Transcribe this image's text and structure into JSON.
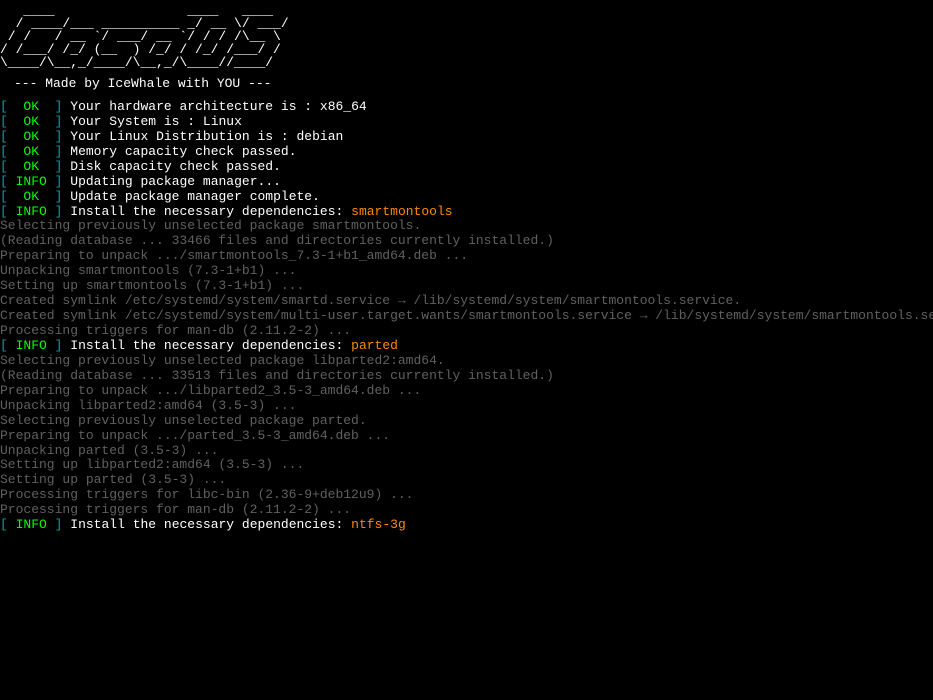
{
  "ascii_art": "   ____                 ____   ____\n  / ____/___ __________ _/ __ \\/ ___/\n / /   / __ `/ ___/ __ `/ / / /\\__ \\\n/ /___/ /_/ (__  ) /_/ / /_/ /___/ /\n\\____/\\__,_/____/\\__,_/\\____//____/",
  "tagline": "--- Made by IceWhale with YOU ---",
  "status_lines": [
    {
      "type": "ok",
      "message": "Your hardware architecture is : x86_64"
    },
    {
      "type": "ok",
      "message": "Your System is : Linux"
    },
    {
      "type": "ok",
      "message": "Your Linux Distribution is : debian"
    },
    {
      "type": "ok",
      "message": "Memory capacity check passed."
    },
    {
      "type": "ok",
      "message": "Disk capacity check passed."
    },
    {
      "type": "info",
      "message": "Updating package manager..."
    },
    {
      "type": "ok",
      "message": "Update package manager complete."
    },
    {
      "type": "info",
      "message": "Install the necessary dependencies: ",
      "pkg": "smartmontools"
    }
  ],
  "output_block_1": [
    "Selecting previously unselected package smartmontools.",
    "(Reading database ... 33466 files and directories currently installed.)",
    "Preparing to unpack .../smartmontools_7.3-1+b1_amd64.deb ...",
    "Unpacking smartmontools (7.3-1+b1) ...",
    "Setting up smartmontools (7.3-1+b1) ...",
    "Created symlink /etc/systemd/system/smartd.service → /lib/systemd/system/smartmontools.service.",
    "Created symlink /etc/systemd/system/multi-user.target.wants/smartmontools.service → /lib/systemd/system/smartmontools.service.",
    "Processing triggers for man-db (2.11.2-2) ..."
  ],
  "status_line_parted": {
    "type": "info",
    "message": "Install the necessary dependencies: ",
    "pkg": "parted"
  },
  "output_block_2": [
    "Selecting previously unselected package libparted2:amd64.",
    "(Reading database ... 33513 files and directories currently installed.)",
    "Preparing to unpack .../libparted2_3.5-3_amd64.deb ...",
    "Unpacking libparted2:amd64 (3.5-3) ...",
    "Selecting previously unselected package parted.",
    "Preparing to unpack .../parted_3.5-3_amd64.deb ...",
    "Unpacking parted (3.5-3) ...",
    "Setting up libparted2:amd64 (3.5-3) ...",
    "Setting up parted (3.5-3) ...",
    "Processing triggers for libc-bin (2.36-9+deb12u9) ...",
    "Processing triggers for man-db (2.11.2-2) ..."
  ],
  "status_line_ntfs": {
    "type": "info",
    "message": "Install the necessary dependencies: ",
    "pkg": "ntfs-3g"
  },
  "labels": {
    "ok": "OK",
    "info": "INFO"
  }
}
